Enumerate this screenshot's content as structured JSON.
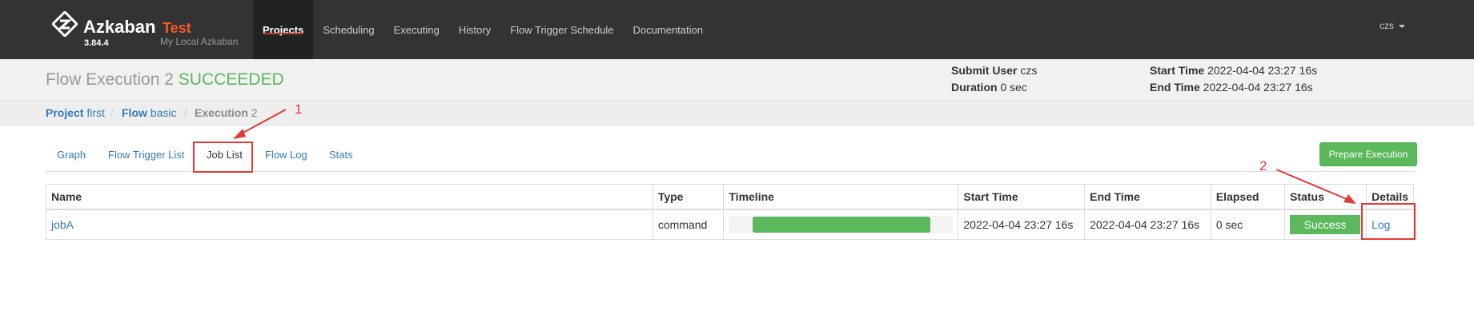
{
  "app": {
    "brand": "Azkaban",
    "env": "Test",
    "version": "3.84.4",
    "subtitle": "My Local Azkaban"
  },
  "nav": {
    "items": [
      {
        "label": "Projects",
        "active": true
      },
      {
        "label": "Scheduling"
      },
      {
        "label": "Executing"
      },
      {
        "label": "History"
      },
      {
        "label": "Flow Trigger Schedule"
      },
      {
        "label": "Documentation"
      }
    ],
    "user": "czs"
  },
  "header": {
    "title_prefix": "Flow Execution 2",
    "status": "SUCCEEDED",
    "submit_user_label": "Submit User",
    "submit_user": "czs",
    "duration_label": "Duration",
    "duration": "0 sec",
    "start_time_label": "Start Time",
    "start_time": "2022-04-04 23:27 16s",
    "end_time_label": "End Time",
    "end_time": "2022-04-04 23:27 16s"
  },
  "breadcrumb": {
    "project_label": "Project",
    "project": "first",
    "flow_label": "Flow",
    "flow": "basic",
    "execution_label": "Execution",
    "execution": "2"
  },
  "tabs": [
    {
      "label": "Graph"
    },
    {
      "label": "Flow Trigger List"
    },
    {
      "label": "Job List",
      "active": true
    },
    {
      "label": "Flow Log"
    },
    {
      "label": "Stats"
    }
  ],
  "prepare_button": "Prepare Execution",
  "table": {
    "columns": [
      "Name",
      "Type",
      "Timeline",
      "Start Time",
      "End Time",
      "Elapsed",
      "Status",
      "Details"
    ],
    "rows": [
      {
        "name": "jobA",
        "type": "command",
        "start": "2022-04-04 23:27 16s",
        "end": "2022-04-04 23:27 16s",
        "elapsed": "0 sec",
        "status": "Success",
        "details": "Log"
      }
    ]
  },
  "annotations": {
    "one": "1",
    "two": "2",
    "color": "#e53935"
  },
  "colors": {
    "success": "#5cb85c",
    "link": "#337ab7",
    "navbar": "#333333",
    "env": "#f15a24"
  }
}
